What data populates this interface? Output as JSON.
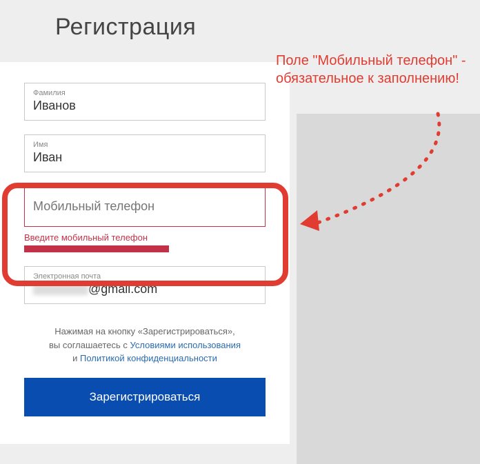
{
  "page": {
    "title": "Регистрация"
  },
  "fields": {
    "surname": {
      "label": "Фамилия",
      "value": "Иванов"
    },
    "name": {
      "label": "Имя",
      "value": "Иван"
    },
    "phone": {
      "placeholder": "Мобильный телефон",
      "error": "Введите мобильный телефон"
    },
    "email": {
      "label": "Электронная почта",
      "domain": "@gmail.com"
    }
  },
  "consent": {
    "line1_a": "Нажимая на кнопку «Зарегистрироваться»,",
    "line2_a": "вы соглашаетесь с ",
    "terms": "Условиями использования",
    "line3_a": "и ",
    "privacy": "Политикой конфиденциальности"
  },
  "button": {
    "register": "Зарегистрироваться"
  },
  "annotation": {
    "text": "Поле \"Мобильный телефон\" - обязательное к заполнению!"
  }
}
